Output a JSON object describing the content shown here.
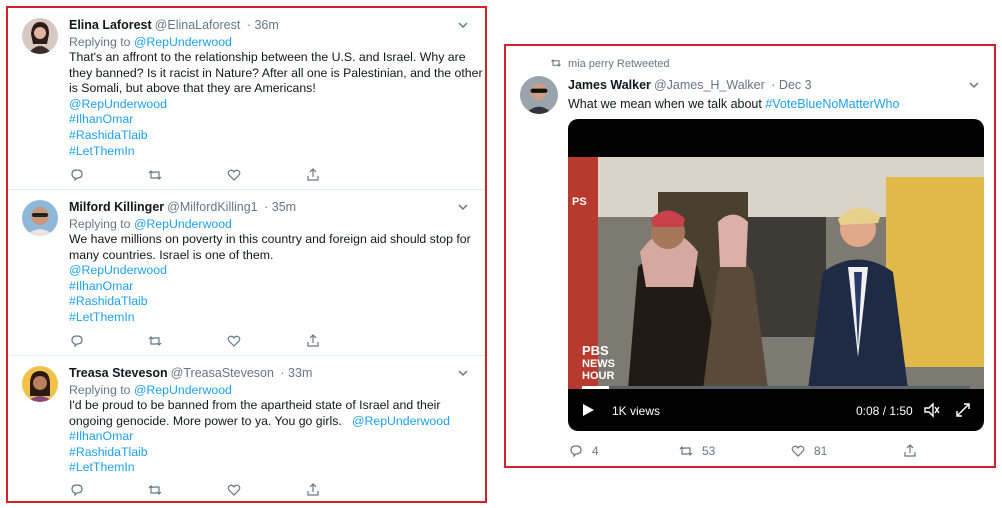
{
  "left_panel": {
    "tweets": [
      {
        "name": "Elina Laforest",
        "handle": "@ElinaLaforest",
        "time": "· 36m",
        "replying_prefix": "Replying to ",
        "replying_to": "@RepUnderwood",
        "text_lines": [
          "That's an affront to the relationship between the U.S. and Israel. Why are",
          "they banned? Is it racist in Nature? After all one is Palestinian, and the other",
          "is Somali, but above that they are Americans!"
        ],
        "tags": [
          "@RepUnderwood",
          "#IlhanOmar",
          "#RashidaTlaib",
          "#LetThemIn"
        ]
      },
      {
        "name": "Milford Killinger",
        "handle": "@MilfordKilling1",
        "time": "· 35m",
        "replying_prefix": "Replying to ",
        "replying_to": "@RepUnderwood",
        "text_lines": [
          "We have millions on poverty in this country and foreign aid should stop for",
          "many countries. Israel is one of them."
        ],
        "tags": [
          "@RepUnderwood",
          "#IlhanOmar",
          "#RashidaTlaib",
          "#LetThemIn"
        ]
      },
      {
        "name": "Treasa Steveson",
        "handle": "@TreasaSteveson",
        "time": "· 33m",
        "replying_prefix": "Replying to ",
        "replying_to": "@RepUnderwood",
        "text_lines": [
          "I'd be proud to be banned from the apartheid state of Israel and their",
          "ongoing genocide. More power to ya. You go girls."
        ],
        "inline_mention": "@RepUnderwood",
        "tags": [
          "#IlhanOmar",
          "#RashidaTlaib",
          "#LetThemIn"
        ]
      }
    ]
  },
  "right_panel": {
    "retweet_label": "mia perry Retweeted",
    "name": "James Walker",
    "handle": "@James_H_Walker",
    "time": "· Dec 3",
    "text": "What we mean when we talk about ",
    "hashtag": "#VoteBlueNoMatterWho",
    "video": {
      "overlay_left": "PS",
      "logo_line1": "PBS",
      "logo_line2": "NEWS",
      "logo_line3": "HOUR",
      "views": "1K views",
      "time": "0:08 / 1:50",
      "progress": 0.07
    },
    "counts": {
      "replies": "4",
      "retweets": "53",
      "likes": "81"
    }
  },
  "colors": {
    "border": "#d0232a",
    "link": "#1da1f2",
    "muted": "#657786"
  }
}
